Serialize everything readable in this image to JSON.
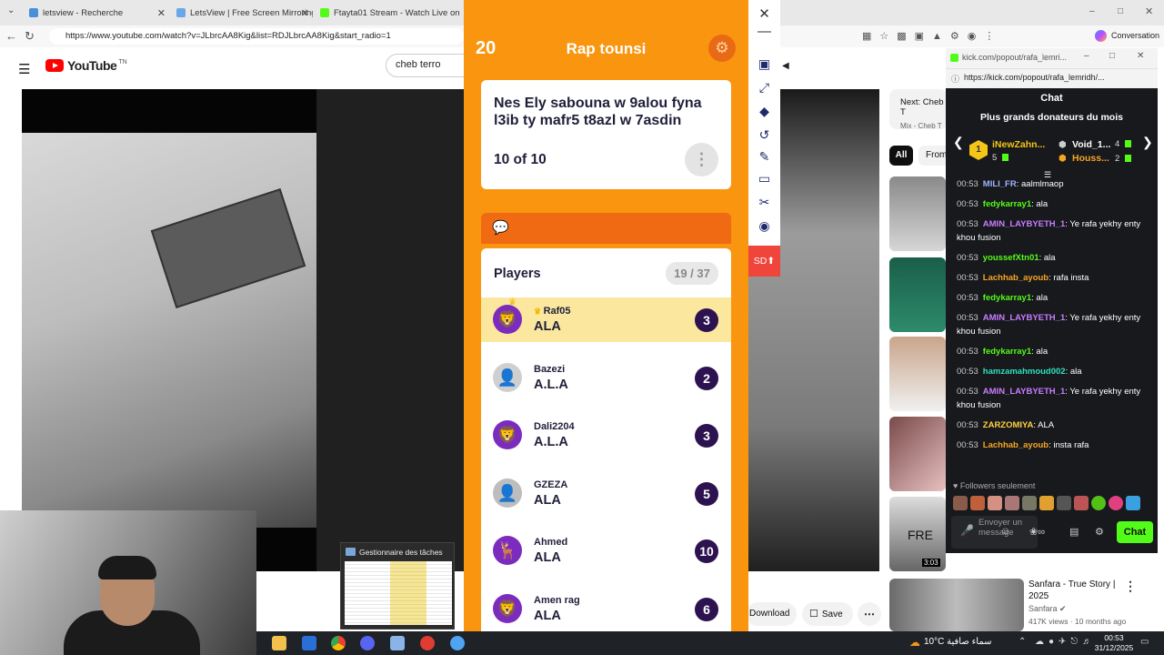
{
  "browser": {
    "tabs": [
      {
        "title": "letsview - Recherche",
        "icon_color": "#4a90d9"
      },
      {
        "title": "LetsView | Free Screen Mirroring A",
        "icon_color": "#6aa7e8"
      },
      {
        "title": "Ftayta01 Stream - Watch Live on K",
        "icon_color": "#53fc18"
      }
    ],
    "url": "https://www.youtube.com/watch?v=JLbrcAA8Kig&list=RDJLbrcAA8Kig&start_radio=1",
    "conversation_label": "Conversation"
  },
  "youtube": {
    "logo": "YouTube",
    "region": "TN",
    "search_value": "cheb terro",
    "next_label": "Next: Cheb T",
    "next_sub": "Mix - Cheb T",
    "chips": [
      "All",
      "From"
    ],
    "actions": {
      "download": "Download",
      "save": "Save"
    },
    "thumb_badges": {
      "fre": "FRE",
      "duration": "3:03"
    },
    "recommendation": {
      "title": "Sanfara - True Story | 2025",
      "channel": "Sanfara",
      "meta": "417K views · 10 months ago"
    }
  },
  "quiz": {
    "count": "20",
    "title": "Rap tounsi",
    "question": "Nes Ely sabouna w 9alou fyna l3ib ty mafr5 t8azl w 7asdin",
    "progress": "10 of 10",
    "players_title": "Players",
    "players_count": "19 / 37",
    "players": [
      {
        "name": "Raf05",
        "answer": "ALA",
        "score": "3",
        "highlight": true,
        "avatar": "🦁",
        "avatar_bg": "#7b2cbf"
      },
      {
        "name": "Bazezi",
        "answer": "A.L.A",
        "score": "2",
        "highlight": false,
        "avatar": "👤",
        "avatar_bg": "#cfcfcf"
      },
      {
        "name": "Dali2204",
        "answer": "A.L.A",
        "score": "3",
        "highlight": false,
        "avatar": "🦁",
        "avatar_bg": "#7b2cbf"
      },
      {
        "name": "GZEZA",
        "answer": "ALA",
        "score": "5",
        "highlight": false,
        "avatar": "👤",
        "avatar_bg": "#bdbdbd"
      },
      {
        "name": "Ahmed",
        "answer": "ALA",
        "score": "10",
        "highlight": false,
        "avatar": "🦌",
        "avatar_bg": "#7b2cbf"
      },
      {
        "name": "Amen rag",
        "answer": "ALA",
        "score": "6",
        "highlight": false,
        "avatar": "🦁",
        "avatar_bg": "#7b2cbf"
      }
    ]
  },
  "toolbar": {
    "sd_label": "SD"
  },
  "taskmanager": {
    "title": "Gestionnaire des tâches"
  },
  "kick": {
    "window_title": "kick.com/popout/rafa_lemri...",
    "url": "https://kick.com/popout/rafa_lemridh/...",
    "chat_title": "Chat",
    "donors_title": "Plus grands donateurs du mois",
    "donors": [
      {
        "name": "iNewZahn...",
        "amount": "5",
        "rank": "1",
        "color": "#f5c518"
      },
      {
        "name": "Void_1...",
        "amount": "4",
        "color": "#ffffff"
      },
      {
        "name": "Houss...",
        "amount": "2",
        "color": "#f5a623"
      }
    ],
    "messages": [
      {
        "time": "00:53",
        "user": "MILI_FR",
        "text": "aalmlmaop",
        "color": "#9db4ff"
      },
      {
        "time": "00:53",
        "user": "fedykarray1",
        "text": "ala",
        "color": "#53fc18"
      },
      {
        "time": "00:53",
        "user": "AMIN_LAYBYETH_1",
        "text": "Ye rafa yekhy enty khou fusion",
        "color": "#c77dff"
      },
      {
        "time": "00:53",
        "user": "youssefXtn01",
        "text": "ala",
        "color": "#53fc18"
      },
      {
        "time": "00:53",
        "user": "Lachhab_ayoub",
        "text": "rafa insta",
        "color": "#f5a623"
      },
      {
        "time": "00:53",
        "user": "fedykarray1",
        "text": "ala",
        "color": "#53fc18"
      },
      {
        "time": "00:53",
        "user": "AMIN_LAYBYETH_1",
        "text": "Ye rafa yekhy enty khou fusion",
        "color": "#c77dff"
      },
      {
        "time": "00:53",
        "user": "fedykarray1",
        "text": "ala",
        "color": "#53fc18"
      },
      {
        "time": "00:53",
        "user": "hamzamahmoud002",
        "text": "ala",
        "color": "#2fe0c0"
      },
      {
        "time": "00:53",
        "user": "AMIN_LAYBYETH_1",
        "text": "Ye rafa yekhy enty khou fusion",
        "color": "#c77dff"
      },
      {
        "time": "00:53",
        "user": "ZARZOMIYA",
        "text": "ALA",
        "color": "#ffd23f"
      },
      {
        "time": "00:53",
        "user": "Lachhab_ayoub",
        "text": "insta rafa",
        "color": "#f5a623"
      }
    ],
    "followers_only": "Followers seulement",
    "input_placeholder": "Envoyer un message",
    "chat_button": "Chat",
    "accent": "#53fc18"
  },
  "taskbar": {
    "weather": "10°C سماء صافية",
    "time": "00:53",
    "date": "31/12/2025"
  }
}
